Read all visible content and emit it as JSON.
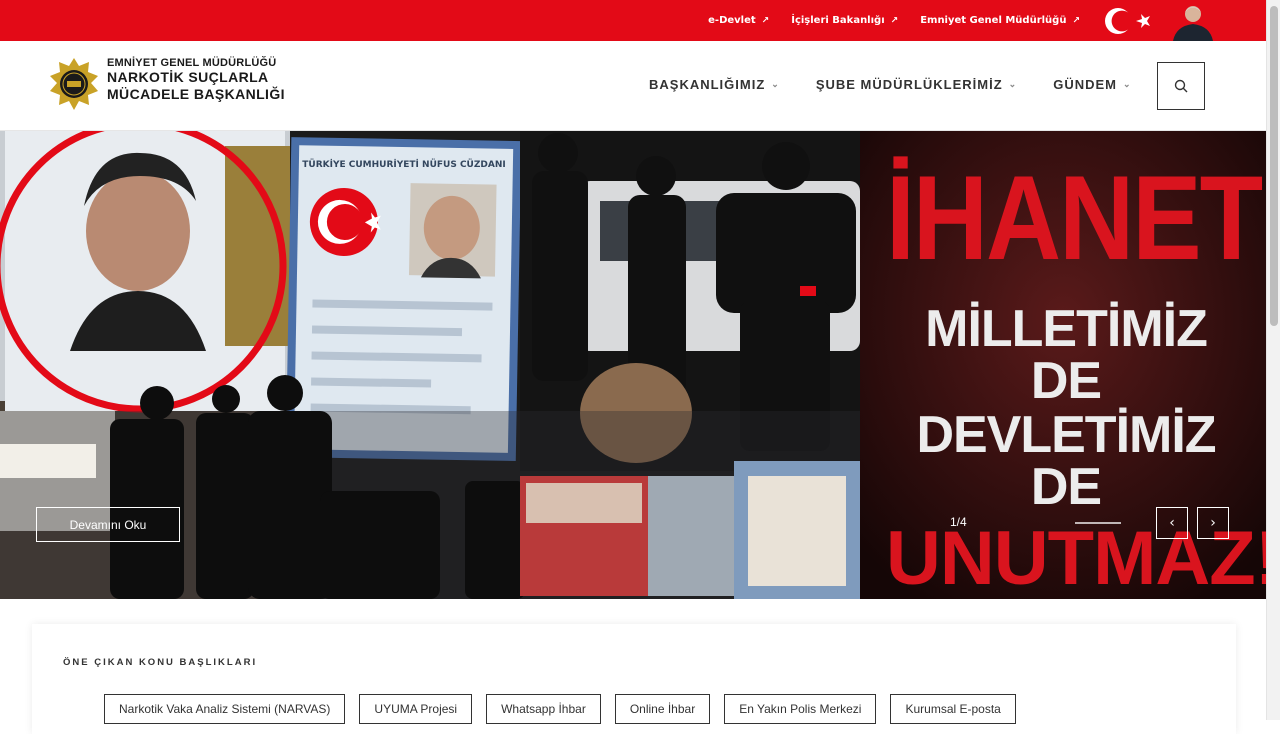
{
  "topbar": {
    "links": [
      {
        "label": "e-Devlet"
      },
      {
        "label": "İçişleri Bakanlığı"
      },
      {
        "label": "Emniyet Genel Müdürlüğü"
      }
    ]
  },
  "brand": {
    "line1": "EMNİYET GENEL MÜDÜRLÜĞÜ",
    "line2": "NARKOTİK SUÇLARLA",
    "line3": "MÜCADELE BAŞKANLIĞI"
  },
  "nav": {
    "items": [
      {
        "label": "BAŞKANLIĞIMIZ"
      },
      {
        "label": "ŞUBE MÜDÜRLÜKLERİMİZ"
      },
      {
        "label": "GÜNDEM"
      }
    ]
  },
  "hero": {
    "headline1": "İHANETİ",
    "headline2": "MİLLETİMİZ DE",
    "headline3": "DEVLETİMİZ DE",
    "headline4": "UNUTMAZ!",
    "read_more": "Devamını Oku",
    "counter": "1/4",
    "slide_progress": 0.25,
    "id_card_title": "TÜRKİYE CUMHURİYETİ NÜFUS CÜZDANI"
  },
  "featured": {
    "title": "ÖNE ÇIKAN KONU BAŞLIKLARI",
    "chips": [
      {
        "label": "Narkotik Vaka Analiz Sistemi (NARVAS)"
      },
      {
        "label": "UYUMA Projesi"
      },
      {
        "label": "Whatsapp İhbar"
      },
      {
        "label": "Online İhbar"
      },
      {
        "label": "En Yakın Polis Merkezi"
      },
      {
        "label": "Kurumsal E-posta"
      }
    ]
  },
  "colors": {
    "brand_red": "#e30a17",
    "headline_red": "#d9141e"
  },
  "icons": {
    "search": "search-icon",
    "external": "external-arrow-icon",
    "prev": "chevron-left-icon",
    "next": "chevron-right-icon"
  }
}
